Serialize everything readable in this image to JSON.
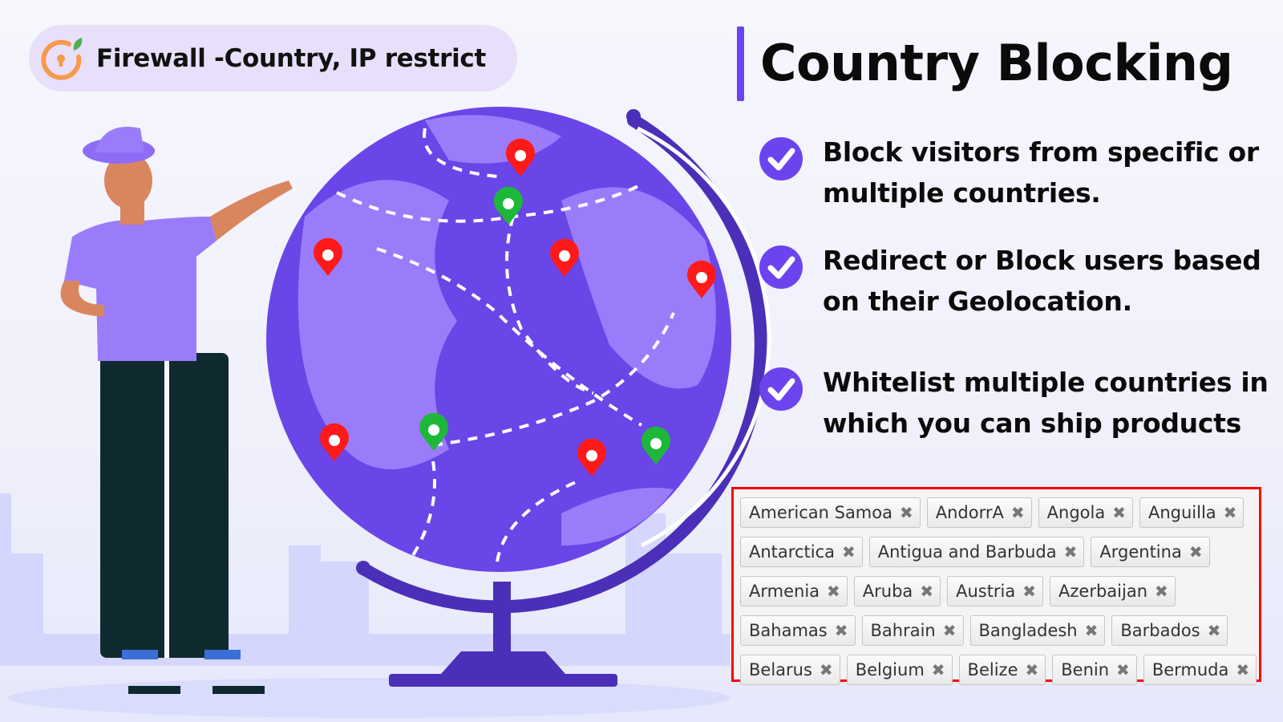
{
  "brand": {
    "name": "Firewall -Country, IP restrict",
    "logo_icon": "lock-timer-leaf-icon",
    "logo_color": "#f79a4c",
    "leaf_color": "#4caf50"
  },
  "heading": {
    "title": "Country Blocking",
    "accent": "#6c44ee"
  },
  "features": [
    {
      "icon": "check-circle-icon",
      "text": "Block visitors from specific or multiple countries."
    },
    {
      "icon": "check-circle-icon",
      "text": "Redirect or Block users based on their Geolocation."
    },
    {
      "icon": "check-circle-icon",
      "text": "Whitelist multiple countries in which you can ship products"
    }
  ],
  "country_tags": {
    "remove_icon": "✖",
    "rows": [
      [
        "American Samoa",
        "AndorrA",
        "Angola",
        "Anguilla"
      ],
      [
        "Antarctica",
        "Antigua and Barbuda",
        "Argentina"
      ],
      [
        "Armenia",
        "Aruba",
        "Austria",
        "Azerbaijan"
      ],
      [
        "Bahamas",
        "Bahrain",
        "Bangladesh",
        "Barbados"
      ],
      [
        "Belarus",
        "Belgium",
        "Belize",
        "Benin",
        "Bermuda"
      ]
    ]
  },
  "illustration": {
    "globe_color": "#6a45e8",
    "blocked_pin_color": "#ff1a1a",
    "allowed_pin_color": "#1db83a"
  }
}
